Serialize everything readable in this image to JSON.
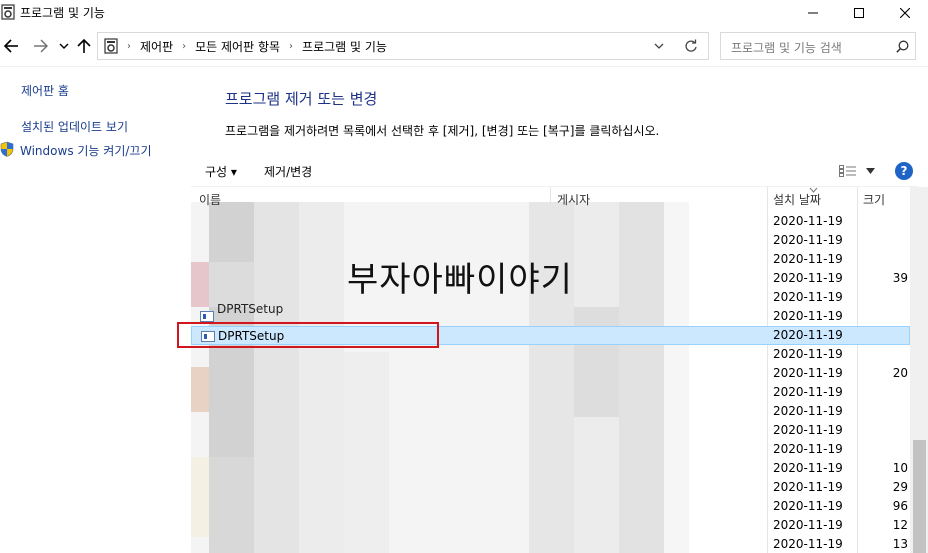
{
  "window": {
    "title": "프로그램 및 기능"
  },
  "address": {
    "crumbs": [
      "제어판",
      "모든 제어판 항목",
      "프로그램 및 기능"
    ],
    "search_placeholder": "프로그램 및 기능 검색"
  },
  "left_pane": {
    "items": [
      "제어판 홈",
      "설치된 업데이트 보기",
      "Windows 기능 켜기/끄기"
    ]
  },
  "main": {
    "heading": "프로그램 제거 또는 변경",
    "description": "프로그램을 제거하려면 목록에서 선택한 후 [제거], [변경] 또는 [복구]를 클릭하십시오."
  },
  "toolbar": {
    "organize": "구성 ▾",
    "uninstall_change": "제거/변경",
    "help": "?"
  },
  "columns": {
    "name": "이름",
    "publisher": "게시자",
    "installed_on": "설치 날짜",
    "size": "크기"
  },
  "rows": [
    {
      "date": "2020-11-19",
      "size": ""
    },
    {
      "date": "2020-11-19",
      "size": ""
    },
    {
      "date": "2020-11-19",
      "size": ""
    },
    {
      "date": "2020-11-19",
      "size": "39"
    },
    {
      "date": "2020-11-19",
      "size": ""
    },
    {
      "date": "2020-11-19",
      "size": "",
      "name": "DPRTSetup"
    },
    {
      "date": "2020-11-19",
      "size": "",
      "name": "DPRTSetup",
      "selected": true
    },
    {
      "date": "2020-11-19",
      "size": ""
    },
    {
      "date": "2020-11-19",
      "size": "20"
    },
    {
      "date": "2020-11-19",
      "size": ""
    },
    {
      "date": "2020-11-19",
      "size": ""
    },
    {
      "date": "2020-11-19",
      "size": ""
    },
    {
      "date": "2020-11-19",
      "size": ""
    },
    {
      "date": "2020-11-19",
      "size": "10"
    },
    {
      "date": "2020-11-19",
      "size": "29"
    },
    {
      "date": "2020-11-19",
      "size": "96"
    },
    {
      "date": "2020-11-19",
      "size": "12"
    },
    {
      "date": "2020-11-19",
      "size": "13"
    }
  ],
  "watermark": "부자아빠이야기",
  "colors": {
    "selection": "#cce8ff",
    "highlight_box": "#d0151c",
    "link": "#1a3d8f",
    "heading": "#1e3287"
  }
}
